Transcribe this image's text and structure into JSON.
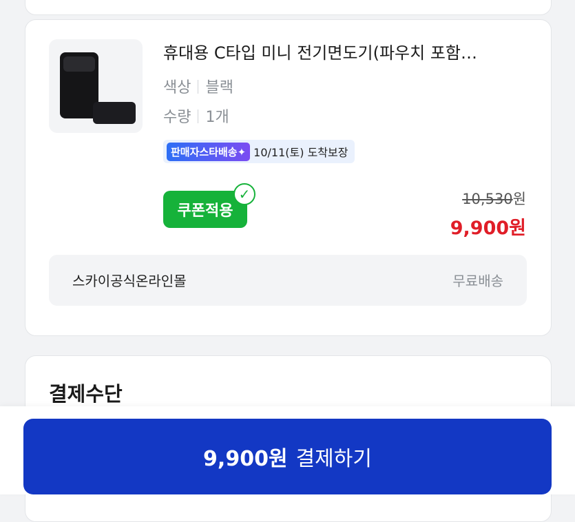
{
  "product": {
    "title": "휴대용 C타입 미니 전기면도기(파우치 포함…",
    "options": [
      {
        "name": "색상",
        "value": "블랙"
      },
      {
        "name": "수량",
        "value": "1개"
      }
    ],
    "delivery_badge": "판매자스타배송✦",
    "delivery_text": "10/11(토) 도착보장",
    "coupon_label": "쿠폰적용",
    "original_price": "10,530",
    "original_unit": "원",
    "sale_price": "9,900원"
  },
  "seller": {
    "name": "스카이공식온라인몰",
    "shipping": "무료배송"
  },
  "payment": {
    "section_title": "결제수단",
    "button_amount": "9,900원",
    "button_label": "결제하기"
  },
  "colors": {
    "coupon_green": "#16b23a",
    "sale_red": "#e01e28",
    "pay_blue": "#1338c4"
  },
  "icons": {
    "coupon_applied": "checkmark-icon"
  }
}
